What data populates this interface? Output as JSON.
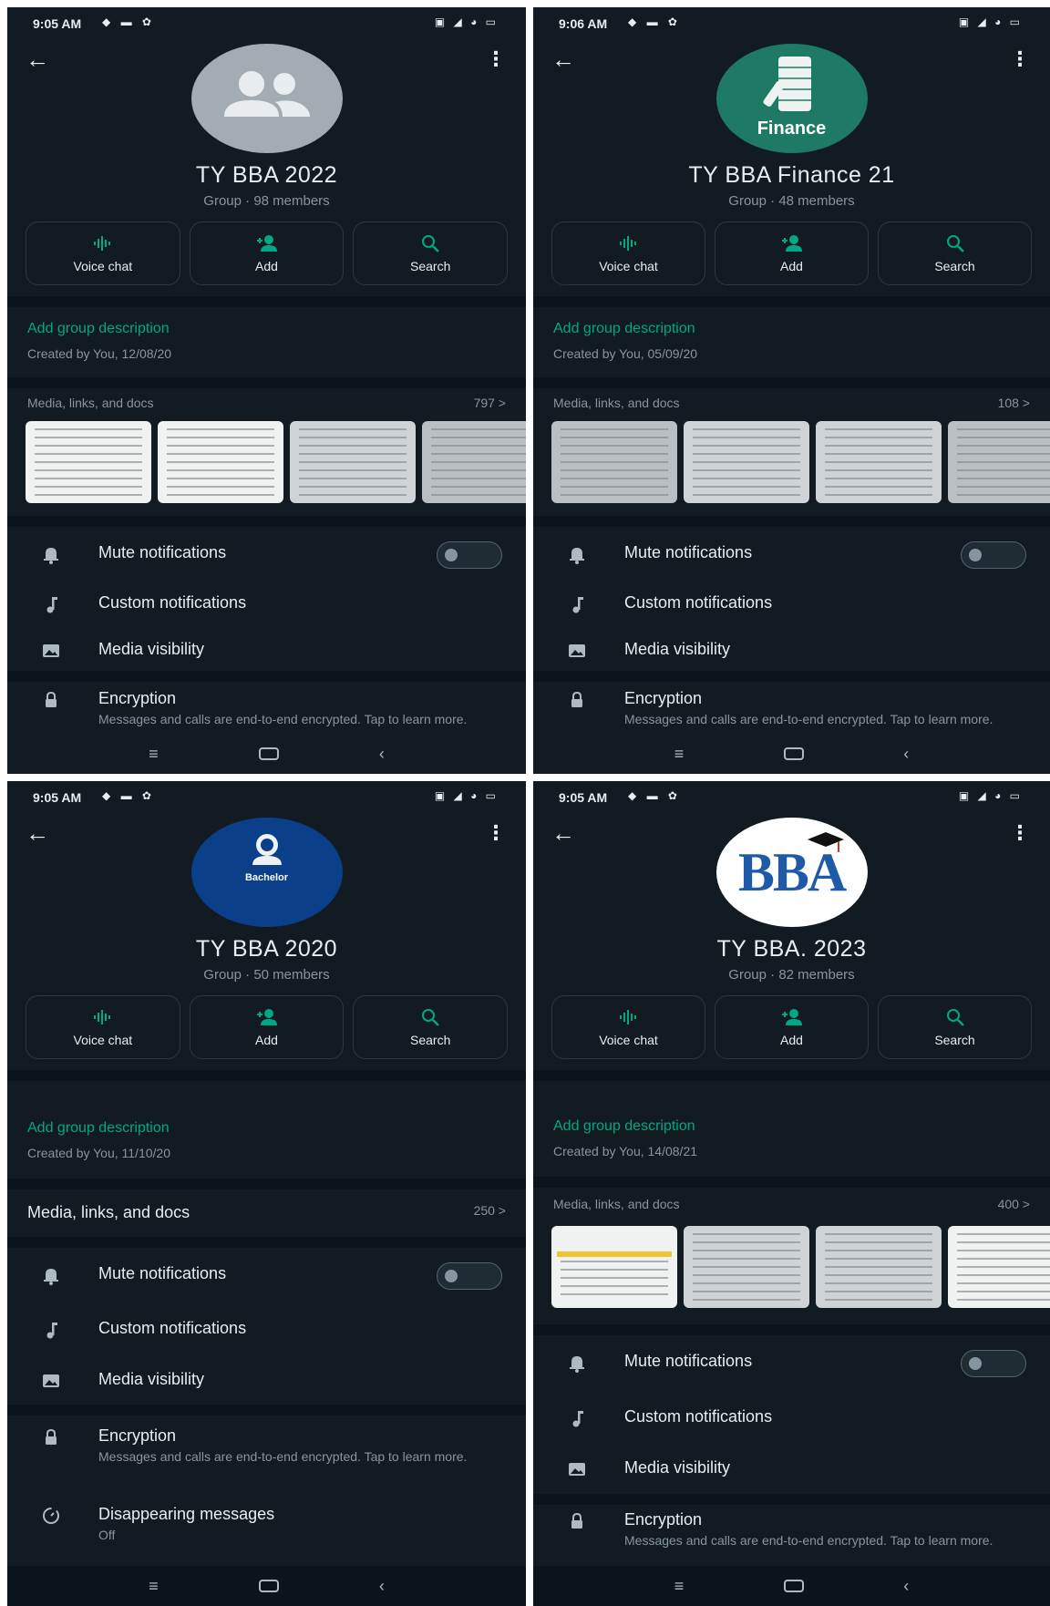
{
  "screens": [
    {
      "status_time": "9:05 AM",
      "group_name": "TY BBA 2022",
      "group_sub": "Group · 98 members",
      "actions": [
        "Voice chat",
        "Add",
        "Search"
      ],
      "description_link": "Add group description",
      "created": "Created by You, 12/08/20",
      "media_label": "Media, links, and docs",
      "media_count": "797 >",
      "settings": {
        "mute": "Mute notifications",
        "custom": "Custom notifications",
        "visibility": "Media visibility",
        "encryption": "Encryption",
        "encryption_sub": "Messages and calls are end-to-end encrypted. Tap to learn more."
      }
    },
    {
      "status_time": "9:06 AM",
      "avatar_text": "Finance",
      "group_name": "TY BBA Finance 21",
      "group_sub": "Group · 48 members",
      "actions": [
        "Voice chat",
        "Add",
        "Search"
      ],
      "description_link": "Add group description",
      "created": "Created by You, 05/09/20",
      "media_label": "Media, links, and docs",
      "media_count": "108 >",
      "settings": {
        "mute": "Mute notifications",
        "custom": "Custom notifications",
        "visibility": "Media visibility",
        "encryption": "Encryption",
        "encryption_sub": "Messages and calls are end-to-end encrypted. Tap to learn more."
      }
    },
    {
      "status_time": "9:05 AM",
      "avatar_text": "Bachelor",
      "group_name": "TY BBA 2020",
      "group_sub": "Group · 50 members",
      "actions": [
        "Voice chat",
        "Add",
        "Search"
      ],
      "description_link": "Add group description",
      "created": "Created by You, 11/10/20",
      "media_label": "Media, links, and docs",
      "media_count": "250 >",
      "settings": {
        "mute": "Mute notifications",
        "custom": "Custom notifications",
        "visibility": "Media visibility",
        "encryption": "Encryption",
        "encryption_sub": "Messages and calls are end-to-end encrypted. Tap to learn more.",
        "disappearing": "Disappearing messages",
        "disappearing_sub": "Off"
      }
    },
    {
      "status_time": "9:05 AM",
      "avatar_text": "BBA",
      "group_name": "TY BBA. 2023",
      "group_sub": "Group · 82 members",
      "actions": [
        "Voice chat",
        "Add",
        "Search"
      ],
      "description_link": "Add group description",
      "created": "Created by You, 14/08/21",
      "media_label": "Media, links, and docs",
      "media_count": "400 >",
      "settings": {
        "mute": "Mute notifications",
        "custom": "Custom notifications",
        "visibility": "Media visibility",
        "encryption": "Encryption",
        "encryption_sub": "Messages and calls are end-to-end encrypted. Tap to learn more."
      }
    }
  ],
  "colors": {
    "background": "#121b22",
    "accent": "#00a884",
    "text": "#e9edef",
    "muted": "#8696a0",
    "finance_avatar": "#1f7a65",
    "bachelor_avatar": "#0c3f8a"
  }
}
